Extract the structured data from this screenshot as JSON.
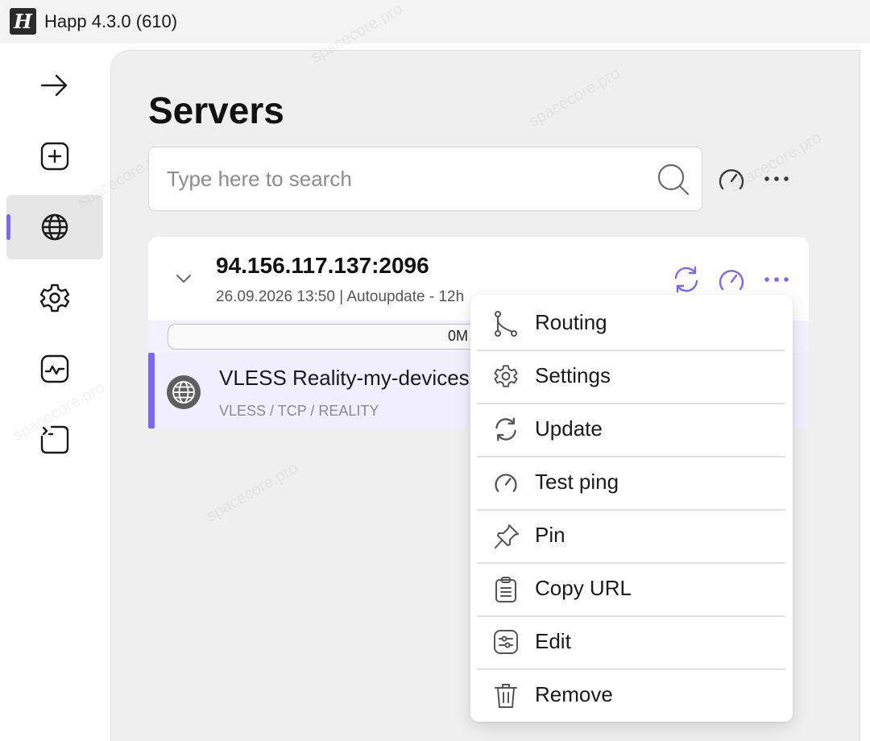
{
  "window": {
    "logo_glyph": "H",
    "title": "Happ 4.3.0 (610)"
  },
  "sidebar": {
    "items": [
      {
        "name": "connect",
        "icon": "arrow-right-icon"
      },
      {
        "name": "add",
        "icon": "plus-square-icon"
      },
      {
        "name": "servers",
        "icon": "globe-icon",
        "active": true
      },
      {
        "name": "settings",
        "icon": "gear-icon"
      },
      {
        "name": "statistics",
        "icon": "activity-icon"
      },
      {
        "name": "logs",
        "icon": "terminal-icon"
      }
    ]
  },
  "page": {
    "title": "Servers"
  },
  "search": {
    "placeholder": "Type here to search",
    "value": ""
  },
  "group": {
    "name": "94.156.117.137:2096",
    "subtitle": "26.09.2026 13:50 | Autoupdate - 12h",
    "traffic_label": "0M"
  },
  "server": {
    "name": "VLESS Reality-my-devices",
    "protocol": "VLESS / TCP / REALITY"
  },
  "context_menu": {
    "items": [
      {
        "label": "Routing",
        "icon": "routing-icon"
      },
      {
        "label": "Settings",
        "icon": "gear-icon"
      },
      {
        "label": "Update",
        "icon": "refresh-icon"
      },
      {
        "label": "Test ping",
        "icon": "speedometer-icon"
      },
      {
        "label": "Pin",
        "icon": "pin-icon"
      },
      {
        "label": "Copy URL",
        "icon": "clipboard-icon"
      },
      {
        "label": "Edit",
        "icon": "sliders-icon"
      },
      {
        "label": "Remove",
        "icon": "trash-icon"
      }
    ]
  },
  "colors": {
    "accent": "#7c68e8",
    "accent_soft": "#f1eefd",
    "panel_bg": "#efefef"
  }
}
